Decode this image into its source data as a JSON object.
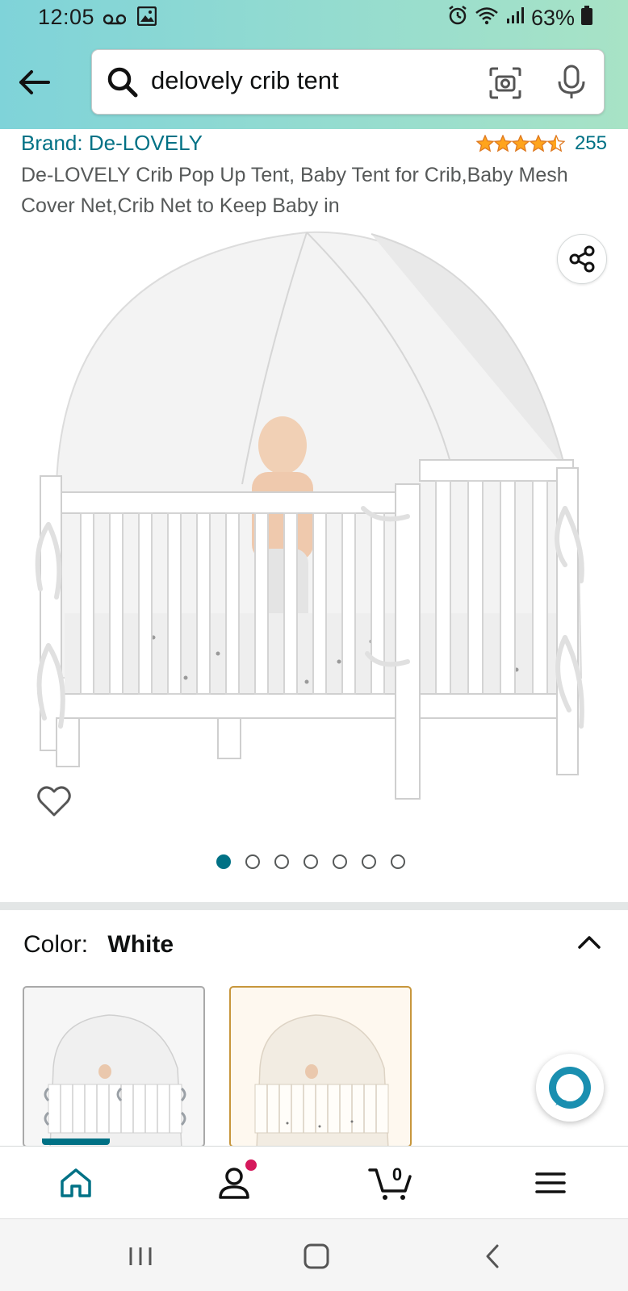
{
  "status_bar": {
    "time": "12:05",
    "battery_percent": "63%"
  },
  "search": {
    "query": "delovely crib tent"
  },
  "product": {
    "brand": "Brand: De-LOVELY",
    "rating_count": "255",
    "rating_stars": 4.5,
    "title": "De-LOVELY Crib Pop Up Tent, Baby Tent for Crib,Baby Mesh Cover Net,Crib Net to Keep Baby in"
  },
  "gallery": {
    "image_count": 7,
    "active_index": 0
  },
  "color": {
    "label": "Color:",
    "value": "White",
    "swatches": [
      {
        "name": "White",
        "selected": true
      },
      {
        "name": "Beige",
        "selected": false
      }
    ]
  },
  "bottom_nav": {
    "items": [
      "home",
      "account",
      "cart",
      "menu"
    ],
    "active": "home",
    "cart_count": "0"
  },
  "colors": {
    "link": "#007185",
    "star": "#ffa41c",
    "header_gradient_start": "#7fd3d9",
    "header_gradient_end": "#a8e3c6",
    "badge": "#d5185b"
  }
}
